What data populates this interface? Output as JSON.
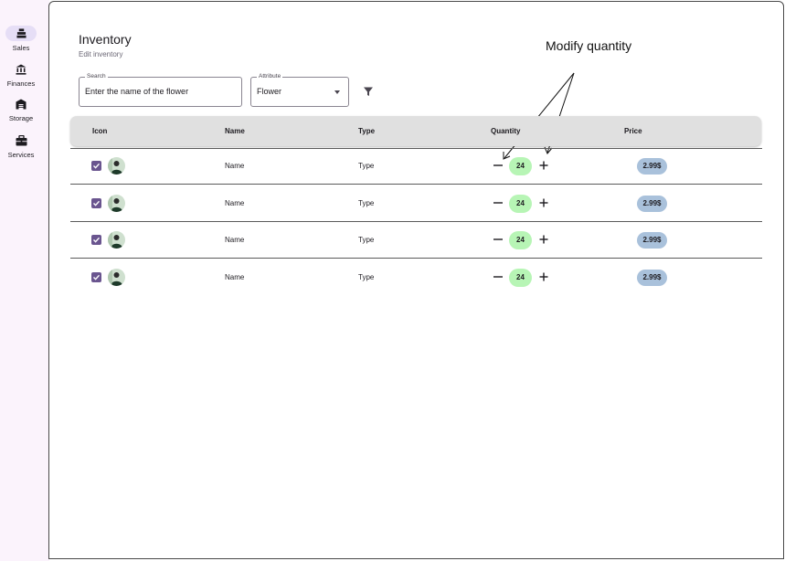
{
  "nav": {
    "items": [
      {
        "label": "Sales",
        "icon": "register-icon",
        "active": true
      },
      {
        "label": "Finances",
        "icon": "bank-icon",
        "active": false
      },
      {
        "label": "Storage",
        "icon": "warehouse-icon",
        "active": false
      },
      {
        "label": "Services",
        "icon": "briefcase-icon",
        "active": false
      }
    ]
  },
  "page": {
    "title": "Inventory",
    "subtitle": "Edit inventory"
  },
  "search": {
    "label": "Search",
    "value": "Enter the name of the flower"
  },
  "attribute": {
    "label": "Attribute",
    "value": "Flower"
  },
  "annotation": {
    "text": "Modify quantity"
  },
  "table": {
    "columns": [
      "Icon",
      "Name",
      "Type",
      "Quantity",
      "Price"
    ],
    "rows": [
      {
        "checked": true,
        "name": "Name",
        "type": "Type",
        "quantity": "24",
        "price": "2.99$"
      },
      {
        "checked": true,
        "name": "Name",
        "type": "Type",
        "quantity": "24",
        "price": "2.99$"
      },
      {
        "checked": true,
        "name": "Name",
        "type": "Type",
        "quantity": "24",
        "price": "2.99$"
      },
      {
        "checked": true,
        "name": "Name",
        "type": "Type",
        "quantity": "24",
        "price": "2.99$"
      }
    ]
  },
  "colors": {
    "accent": "#6a558f",
    "rail_background": "#fbf3fc",
    "active_pill": "#e6def6",
    "quantity_badge": "#b7f5b5",
    "price_badge": "#a9c1db",
    "table_header": "#e0e0e0"
  }
}
